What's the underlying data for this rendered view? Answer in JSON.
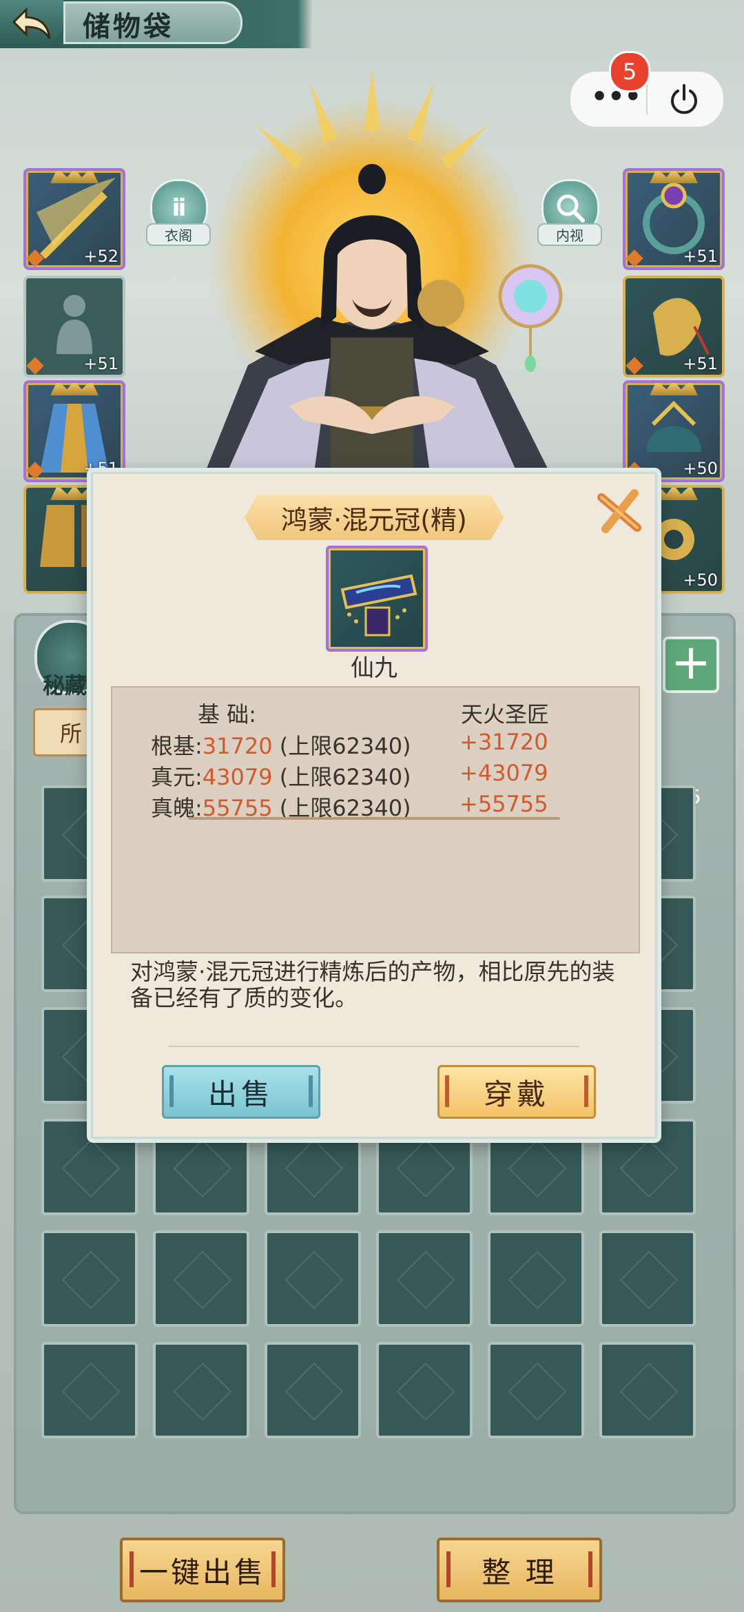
{
  "header": {
    "title": "储物袋"
  },
  "capsule": {
    "badge_count": "5"
  },
  "character": {
    "left_button_label": "衣阁",
    "right_button_label": "内视"
  },
  "left_slots": [
    {
      "level": "+52",
      "filled": true
    },
    {
      "level": "+51",
      "filled": false
    },
    {
      "level": "+51",
      "filled": true
    },
    {
      "level": "",
      "filled": true
    }
  ],
  "right_slots": [
    {
      "level": "+51",
      "filled": true
    },
    {
      "level": "+51",
      "filled": true
    },
    {
      "level": "+50",
      "filled": true
    },
    {
      "level": "+50",
      "filled": true
    }
  ],
  "bag": {
    "secret_label": "秘藏",
    "all_tab": "所",
    "count_partial": "5",
    "sell_all_label": "一键出售",
    "sort_label": "整 理"
  },
  "dialog": {
    "title": "鸿蒙·混元冠(精)",
    "grade": "仙九",
    "base_header": "基 础:",
    "bonus_header": "天火圣匠",
    "stats": [
      {
        "name": "根基:",
        "value": "31720",
        "limit": " (上限62340)",
        "bonus": "+31720"
      },
      {
        "name": "真元:",
        "value": "43079",
        "limit": " (上限62340)",
        "bonus": "+43079"
      },
      {
        "name": "真魄:",
        "value": "55755",
        "limit": " (上限62340)",
        "bonus": "+55755"
      }
    ],
    "description": "对鸿蒙·混元冠进行精炼后的产物，相比原先的装备已经有了质的变化。",
    "sell_label": "出售",
    "wear_label": "穿戴"
  }
}
